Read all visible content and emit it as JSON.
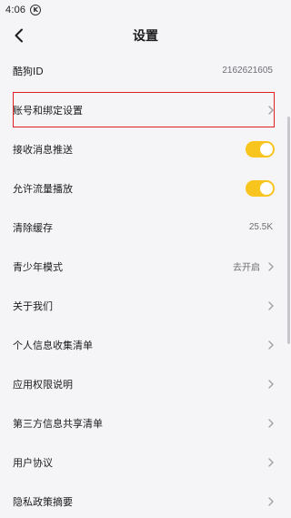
{
  "status_bar": {
    "time": "4:06",
    "notification_icon": "K"
  },
  "header": {
    "title": "设置",
    "back_icon": "chevron-left-icon"
  },
  "settings": {
    "kugou_id": {
      "label": "酷狗ID",
      "value": "2162621605"
    },
    "account_binding": {
      "label": "账号和绑定设置"
    },
    "push_notifications": {
      "label": "接收消息推送",
      "enabled": true
    },
    "allow_data_playback": {
      "label": "允许流量播放",
      "enabled": true
    },
    "clear_cache": {
      "label": "清除缓存",
      "value": "25.5K"
    },
    "teen_mode": {
      "label": "青少年模式",
      "value": "去开启"
    },
    "about_us": {
      "label": "关于我们"
    },
    "personal_info_list": {
      "label": "个人信息收集清单"
    },
    "app_permissions": {
      "label": "应用权限说明"
    },
    "third_party_sharing": {
      "label": "第三方信息共享清单"
    },
    "user_agreement": {
      "label": "用户协议"
    },
    "privacy_summary": {
      "label": "隐私政策摘要"
    }
  },
  "colors": {
    "toggle_on": "#f7c51d",
    "highlight_border": "#e02020",
    "background": "#f5f5f7"
  }
}
